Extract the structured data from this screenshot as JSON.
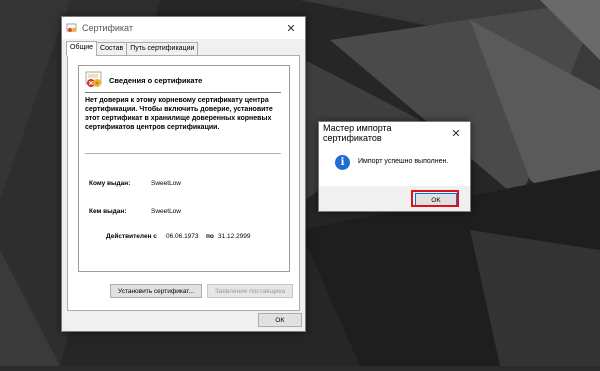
{
  "cert_dialog": {
    "title": "Сертификат",
    "close_glyph": "✕",
    "tabs": [
      {
        "label": "Общие"
      },
      {
        "label": "Состав"
      },
      {
        "label": "Путь сертификации"
      }
    ],
    "header_title": "Сведения о сертификате",
    "warning_text": "Нет доверия к этому корневому сертификату центра сертификации. Чтобы включить доверие, установите этот сертификат в хранилище доверенных корневых сертификатов центров сертификации.",
    "issued_to_label": "Кому выдан:",
    "issued_to_value": "SweetLow",
    "issued_by_label": "Кем выдан:",
    "issued_by_value": "SweetLow",
    "valid_from_label": "Действителен с",
    "valid_from_value": "06.06.1973",
    "valid_to_label": "по",
    "valid_to_value": "31.12.2999",
    "install_button": "Установить сертификат...",
    "issuer_statement_button": "Заявление поставщика",
    "ok_button": "OK"
  },
  "import_dialog": {
    "title": "Мастер импорта сертификатов",
    "close_glyph": "✕",
    "message": "Импорт успешно выполнен.",
    "info_glyph": "i",
    "ok_button": "OK",
    "highlight_color": "#e0101a"
  }
}
